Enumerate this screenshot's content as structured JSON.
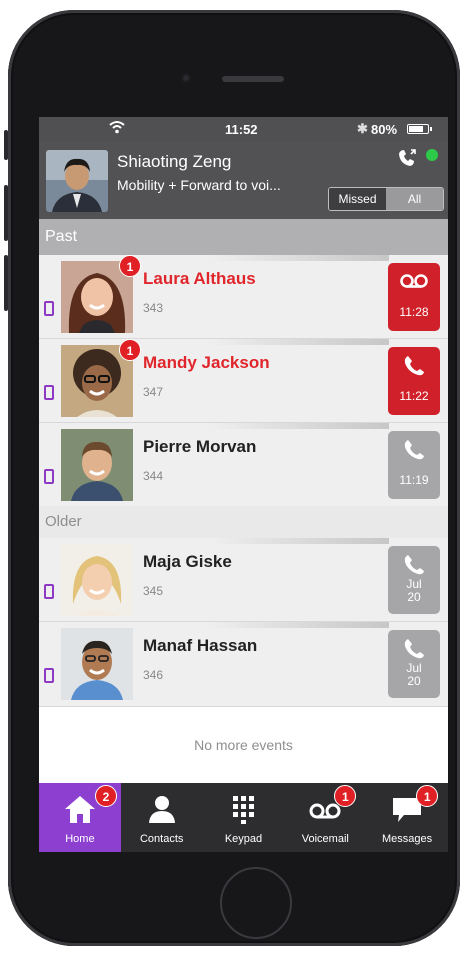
{
  "status_bar": {
    "time": "11:52",
    "battery_percent": "80%",
    "battery_level": 0.8
  },
  "profile": {
    "name": "Shiaoting Zeng",
    "status": "Mobility + Forward to voi..."
  },
  "filter": {
    "missed_label": "Missed",
    "all_label": "All",
    "selected": "All"
  },
  "sections": {
    "past": "Past",
    "older": "Older"
  },
  "events": [
    {
      "name": "Laura Althaus",
      "ext": "343",
      "badge": "1",
      "type": "voicemail",
      "time": "11:28",
      "state": "missed"
    },
    {
      "name": "Mandy Jackson",
      "ext": "347",
      "badge": "1",
      "type": "call",
      "time": "11:22",
      "state": "missed"
    },
    {
      "name": "Pierre Morvan",
      "ext": "344",
      "type": "call",
      "time": "11:19",
      "state": "normal"
    },
    {
      "name": "Maja Giske",
      "ext": "345",
      "type": "call",
      "date_month": "Jul",
      "date_day": "20",
      "state": "normal"
    },
    {
      "name": "Manaf Hassan",
      "ext": "346",
      "type": "call",
      "date_month": "Jul",
      "date_day": "20",
      "state": "normal"
    }
  ],
  "footer_text": "No more events",
  "tabs": [
    {
      "label": "Home",
      "icon": "home-icon",
      "badge": "2",
      "active": true
    },
    {
      "label": "Contacts",
      "icon": "contacts-icon"
    },
    {
      "label": "Keypad",
      "icon": "keypad-icon"
    },
    {
      "label": "Voicemail",
      "icon": "voicemail-icon",
      "badge": "1"
    },
    {
      "label": "Messages",
      "icon": "messages-icon",
      "badge": "1"
    }
  ],
  "colors": {
    "accent": "#8d3fd0",
    "missed": "#e0262b",
    "badge": "#e02024",
    "presence": "#2fc94a"
  }
}
